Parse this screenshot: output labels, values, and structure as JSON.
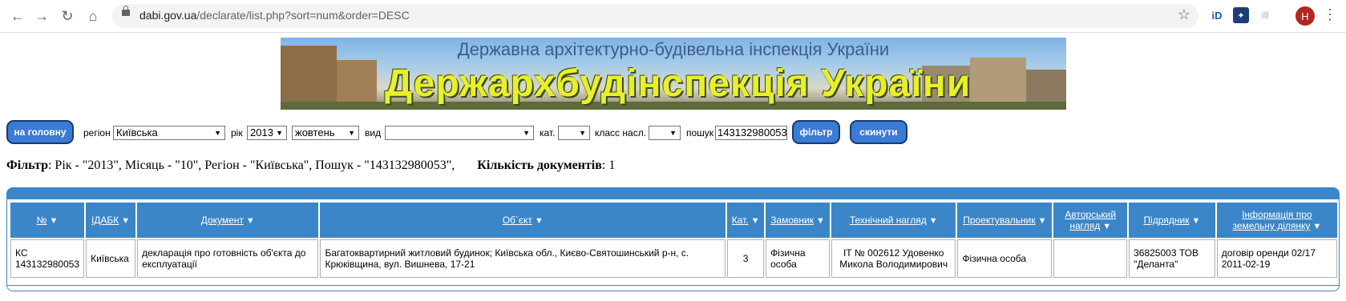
{
  "browser": {
    "url_host": "dabi.gov.ua",
    "url_path": "/declarate/list.php?sort=num&order=DESC",
    "profile_initial": "H"
  },
  "banner": {
    "subtitle": "Державна архітектурно-будівельна інспекція України",
    "title": "Держархбудінспекція України"
  },
  "filter": {
    "home_button": "на головну",
    "region_label": "регіон",
    "region_value": "Київська",
    "year_label": "рік",
    "year_value": "2013",
    "month_value": "жовтень",
    "type_label": "вид",
    "type_value": "",
    "cat_label": "кат.",
    "cat_value": "",
    "class_label": "класс насл.",
    "class_value": "",
    "search_label": "пошук",
    "search_value": "143132980053",
    "filter_button": "фільтр",
    "reset_button": "скинути"
  },
  "summary": {
    "filter_label": "Фільтр",
    "filter_text": ": Рік - \"2013\", Місяць - \"10\", Регіон - \"Київська\", Пошук - \"143132980053\",",
    "count_label": "Кількість документів",
    "count_value": ": 1"
  },
  "table": {
    "headers": [
      "№",
      "ІДАБК",
      "Документ",
      "Об`єкт",
      "Кат.",
      "Замовник",
      "Технічний нагляд",
      "Проектувальник",
      "Авторський нагляд",
      "Підрядник",
      "Інформація про земельну ділянку"
    ],
    "rows": [
      {
        "num": "КС 143132980053",
        "idabk": "Київська",
        "document": "декларація про готовність об'єкта до експлуатації",
        "object": "Багатоквартирний житловий будинок; Київська обл., Києво-Святошинський р-н, с. Крюківщина, вул. Вишнева, 17-21",
        "cat": "3",
        "customer": "Фізична особа",
        "tech_supervision": "ІТ № 002612 Удовенко Микола Володимирович",
        "designer": "Фізична особа",
        "author_supervision": "",
        "contractor": "36825003 ТОВ \"Деланта\"",
        "land_info": "договір оренди 02/17 2011-02-19"
      }
    ]
  }
}
